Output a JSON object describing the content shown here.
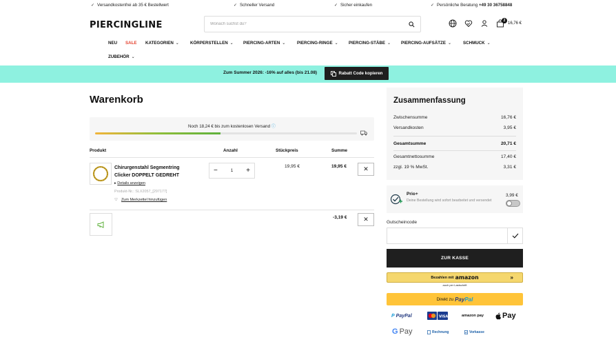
{
  "usp": [
    {
      "text": "Versandkostenfrei ab 35 € Bestellwert"
    },
    {
      "text": "Schneller Versand"
    },
    {
      "text": "Sicher einkaufen"
    },
    {
      "text": "Persönliche Beratung",
      "phone": "+49 30 36758848"
    }
  ],
  "header": {
    "logo": "PIERCINGLINE",
    "search_placeholder": "Wonach suchst du?",
    "cart_count": "2",
    "cart_total": "16,76 €"
  },
  "nav": {
    "items": [
      "NEU",
      "SALE",
      "KATEGORIEN",
      "KÖRPERSTELLEN",
      "PIERCING-ARTEN",
      "PIERCING-RINGE",
      "PIERCING-STÄBE",
      "PIERCING-AUFSÄTZE",
      "SCHMUCK",
      "ZUBEHÖR"
    ]
  },
  "promo": {
    "text": "Zum Summer 2026: -16% auf alles (bis 21.08)",
    "button": "Rabatt Code kopieren"
  },
  "cart": {
    "title": "Warenkorb",
    "shipping_text": "Noch 18,24 € bis zum kostenlosen Versand",
    "shipping_progress": 0.48,
    "columns": {
      "product": "Produkt",
      "qty": "Anzahl",
      "unit": "Stückpreis",
      "sum": "Summe"
    },
    "item": {
      "name": "Chirurgenstahl Segmentring Clicker DOPPELT GEDREHT",
      "details": "Details anzeigen",
      "product_no": "Produkt-Nr.: SLX2057_[297177]",
      "wishlist": "Zum Merkzettel hinzufügen",
      "qty": "1",
      "unit_price": "19,95 €",
      "sum": "19,95 €"
    },
    "discount": {
      "sum": "-3,19 €"
    }
  },
  "summary": {
    "title": "Zusammenfassung",
    "subtotal_label": "Zwischensumme",
    "subtotal": "16,76 €",
    "shipping_label": "Versandkosten",
    "shipping": "3,95 €",
    "total_label": "Gesamtsumme",
    "total": "20,71 €",
    "net_label": "Gesamtnettosumme",
    "net": "17,40 €",
    "vat_label": "zzgl. 19 % MwSt.",
    "vat": "3,31 €"
  },
  "prio": {
    "title": "Prio+",
    "desc": "Deine Bestellung wird sofort bearbeitet und versendet",
    "price": "3,99 €",
    "enabled": false
  },
  "coupon": {
    "label": "Gutscheincode",
    "value": ""
  },
  "checkout": {
    "label": "ZUR KASSE"
  },
  "amazon": {
    "prefix": "Bezahlen mit",
    "brand": "amazon",
    "sub": "auch per Lastschrift"
  },
  "paypal": {
    "prefix": "Direkt zu",
    "brand1": "Pay",
    "brand2": "Pal"
  },
  "payment_logos": {
    "paypal": "PayPal",
    "amazonpay": "amazon pay",
    "applepay": "Pay",
    "googlepay_g": "G",
    "googlepay": "Pay",
    "rechnung": "Rechnung",
    "vorkasse": "Vorkasse"
  }
}
